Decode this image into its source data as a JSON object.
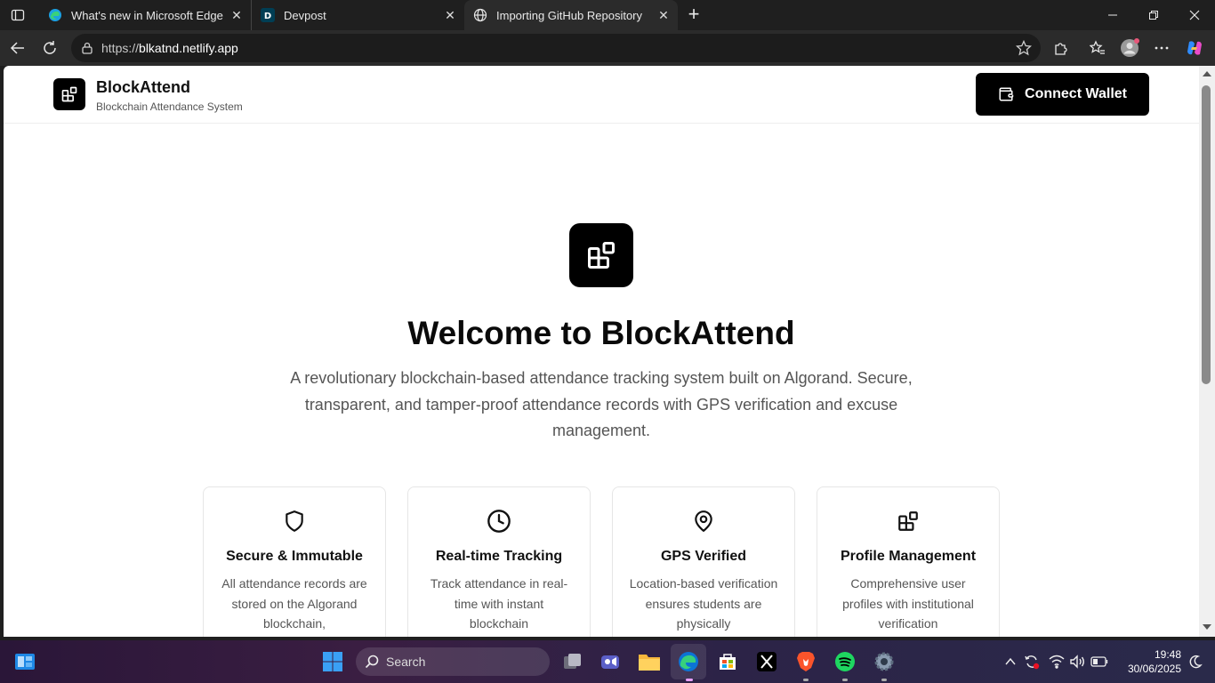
{
  "browser": {
    "tabs": [
      {
        "title": "What's new in Microsoft Edge",
        "icon": "edge-icon"
      },
      {
        "title": "Devpost",
        "icon": "devpost-icon",
        "favicon_letter": "D"
      },
      {
        "title": "Importing GitHub Repository",
        "icon": "globe-icon",
        "active": true
      }
    ],
    "url_prefix": "https://",
    "url_host": "blkatnd.netlify.app"
  },
  "site": {
    "brand_name": "BlockAttend",
    "brand_subtitle": "Blockchain Attendance System",
    "connect_label": "Connect Wallet"
  },
  "hero": {
    "title": "Welcome to BlockAttend",
    "description": "A revolutionary blockchain-based attendance tracking system built on Algorand. Secure, transparent, and tamper-proof attendance records with GPS verification and excuse management."
  },
  "features": [
    {
      "title": "Secure & Immutable",
      "description": "All attendance records are stored on the Algorand blockchain,",
      "icon": "shield-icon"
    },
    {
      "title": "Real-time Tracking",
      "description": "Track attendance in real-time with instant blockchain",
      "icon": "clock-icon"
    },
    {
      "title": "GPS Verified",
      "description": "Location-based verification ensures students are physically",
      "icon": "map-pin-icon"
    },
    {
      "title": "Profile Management",
      "description": "Comprehensive user profiles with institutional verification",
      "icon": "blocks-icon"
    }
  ],
  "taskbar": {
    "search_label": "Search",
    "time": "19:48",
    "date": "30/06/2025"
  },
  "colors": {
    "brand_black": "#000000",
    "chrome_dark": "#1f1f1f",
    "text_muted": "#555555"
  }
}
